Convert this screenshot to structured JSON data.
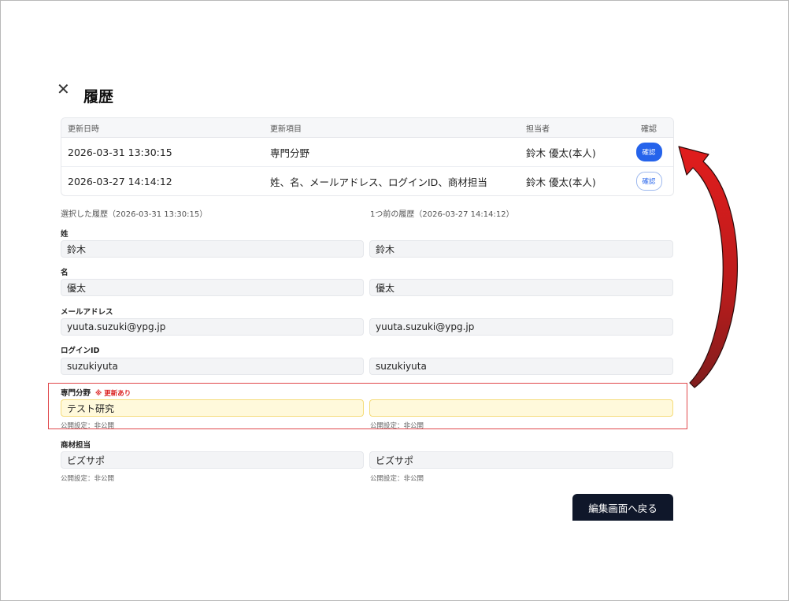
{
  "modal": {
    "title": "履歴"
  },
  "history": {
    "headers": {
      "date": "更新日時",
      "item": "更新項目",
      "user": "担当者",
      "confirm": "確認"
    },
    "rows": [
      {
        "date": "2026-03-31 13:30:15",
        "item": "専門分野",
        "user": "鈴木 優太(本人)",
        "confirm": "確認",
        "active": true
      },
      {
        "date": "2026-03-27 14:14:12",
        "item": "姓、名、メールアドレス、ログインID、商材担当",
        "user": "鈴木 優太(本人)",
        "confirm": "確認",
        "active": false
      }
    ]
  },
  "compare": {
    "selected_label": "選択した履歴（2026-03-31 13:30:15）",
    "previous_label": "1つ前の履歴（2026-03-27 14:14:12）",
    "fields": [
      {
        "label": "姓",
        "left": "鈴木",
        "right": "鈴木"
      },
      {
        "label": "名",
        "left": "優太",
        "right": "優太"
      },
      {
        "label": "メールアドレス",
        "left": "yuuta.suzuki@ypg.jp",
        "right": "yuuta.suzuki@ypg.jp"
      },
      {
        "label": "ログインID",
        "left": "suzukiyuta",
        "right": "suzukiyuta"
      },
      {
        "label": "専門分野",
        "badge": "※ 更新あり",
        "left": "テスト研究",
        "right": "",
        "left_pub": "公開設定：非公開",
        "right_pub": "公開設定：非公開"
      },
      {
        "label": "商材担当",
        "left": "ビズサポ",
        "right": "ビズサポ",
        "left_pub": "公開設定：非公開",
        "right_pub": "公開設定：非公開"
      }
    ]
  },
  "actions": {
    "back": "編集画面へ戻る"
  },
  "colors": {
    "accent": "#2563eb",
    "highlight_border": "#e0484b",
    "arrow": "#d81b1b"
  }
}
